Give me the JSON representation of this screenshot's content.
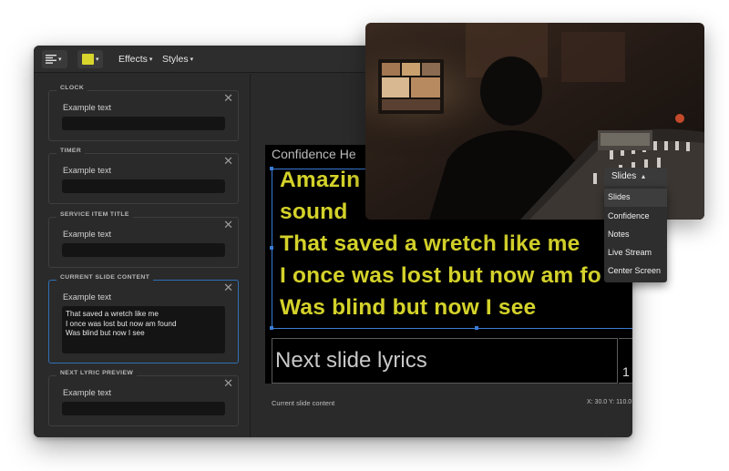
{
  "toolbar": {
    "effects_label": "Effects",
    "styles_label": "Styles",
    "color_swatch": "#d8d62c",
    "caret_glyph": "▾"
  },
  "panel": {
    "close_glyph": "✕",
    "sections": [
      {
        "title": "CLOCK",
        "example": "Example text"
      },
      {
        "title": "TIMER",
        "example": "Example text"
      },
      {
        "title": "SERVICE ITEM TITLE",
        "example": "Example text"
      },
      {
        "title": "CURRENT SLIDE CONTENT",
        "example": "Example text",
        "lines": [
          "That saved a wretch like me",
          "I once was lost but now am found",
          "Was blind but now I see"
        ]
      },
      {
        "title": "NEXT LYRIC PREVIEW",
        "example": "Example text"
      }
    ]
  },
  "stage": {
    "confidence_label": "Confidence He",
    "lyrics": [
      "Amazin",
      "sound",
      "That saved a wretch like me",
      "I once was lost but now am fo",
      "Was blind but now I see"
    ],
    "lyric_color": "#d4d22a",
    "next_slide": "Next slide lyrics",
    "counter": "1"
  },
  "status": {
    "left": "Current slide content",
    "right": "X: 30.0  Y: 110.0"
  },
  "dropdown": {
    "selected": "Slides",
    "caret_glyph": "▴",
    "options": [
      "Slides",
      "Confidence",
      "Notes",
      "Live Stream",
      "Center Screen"
    ]
  },
  "icons": {
    "align": "align-left-icon",
    "close": "close-icon",
    "caret": "chevron-down-icon"
  }
}
